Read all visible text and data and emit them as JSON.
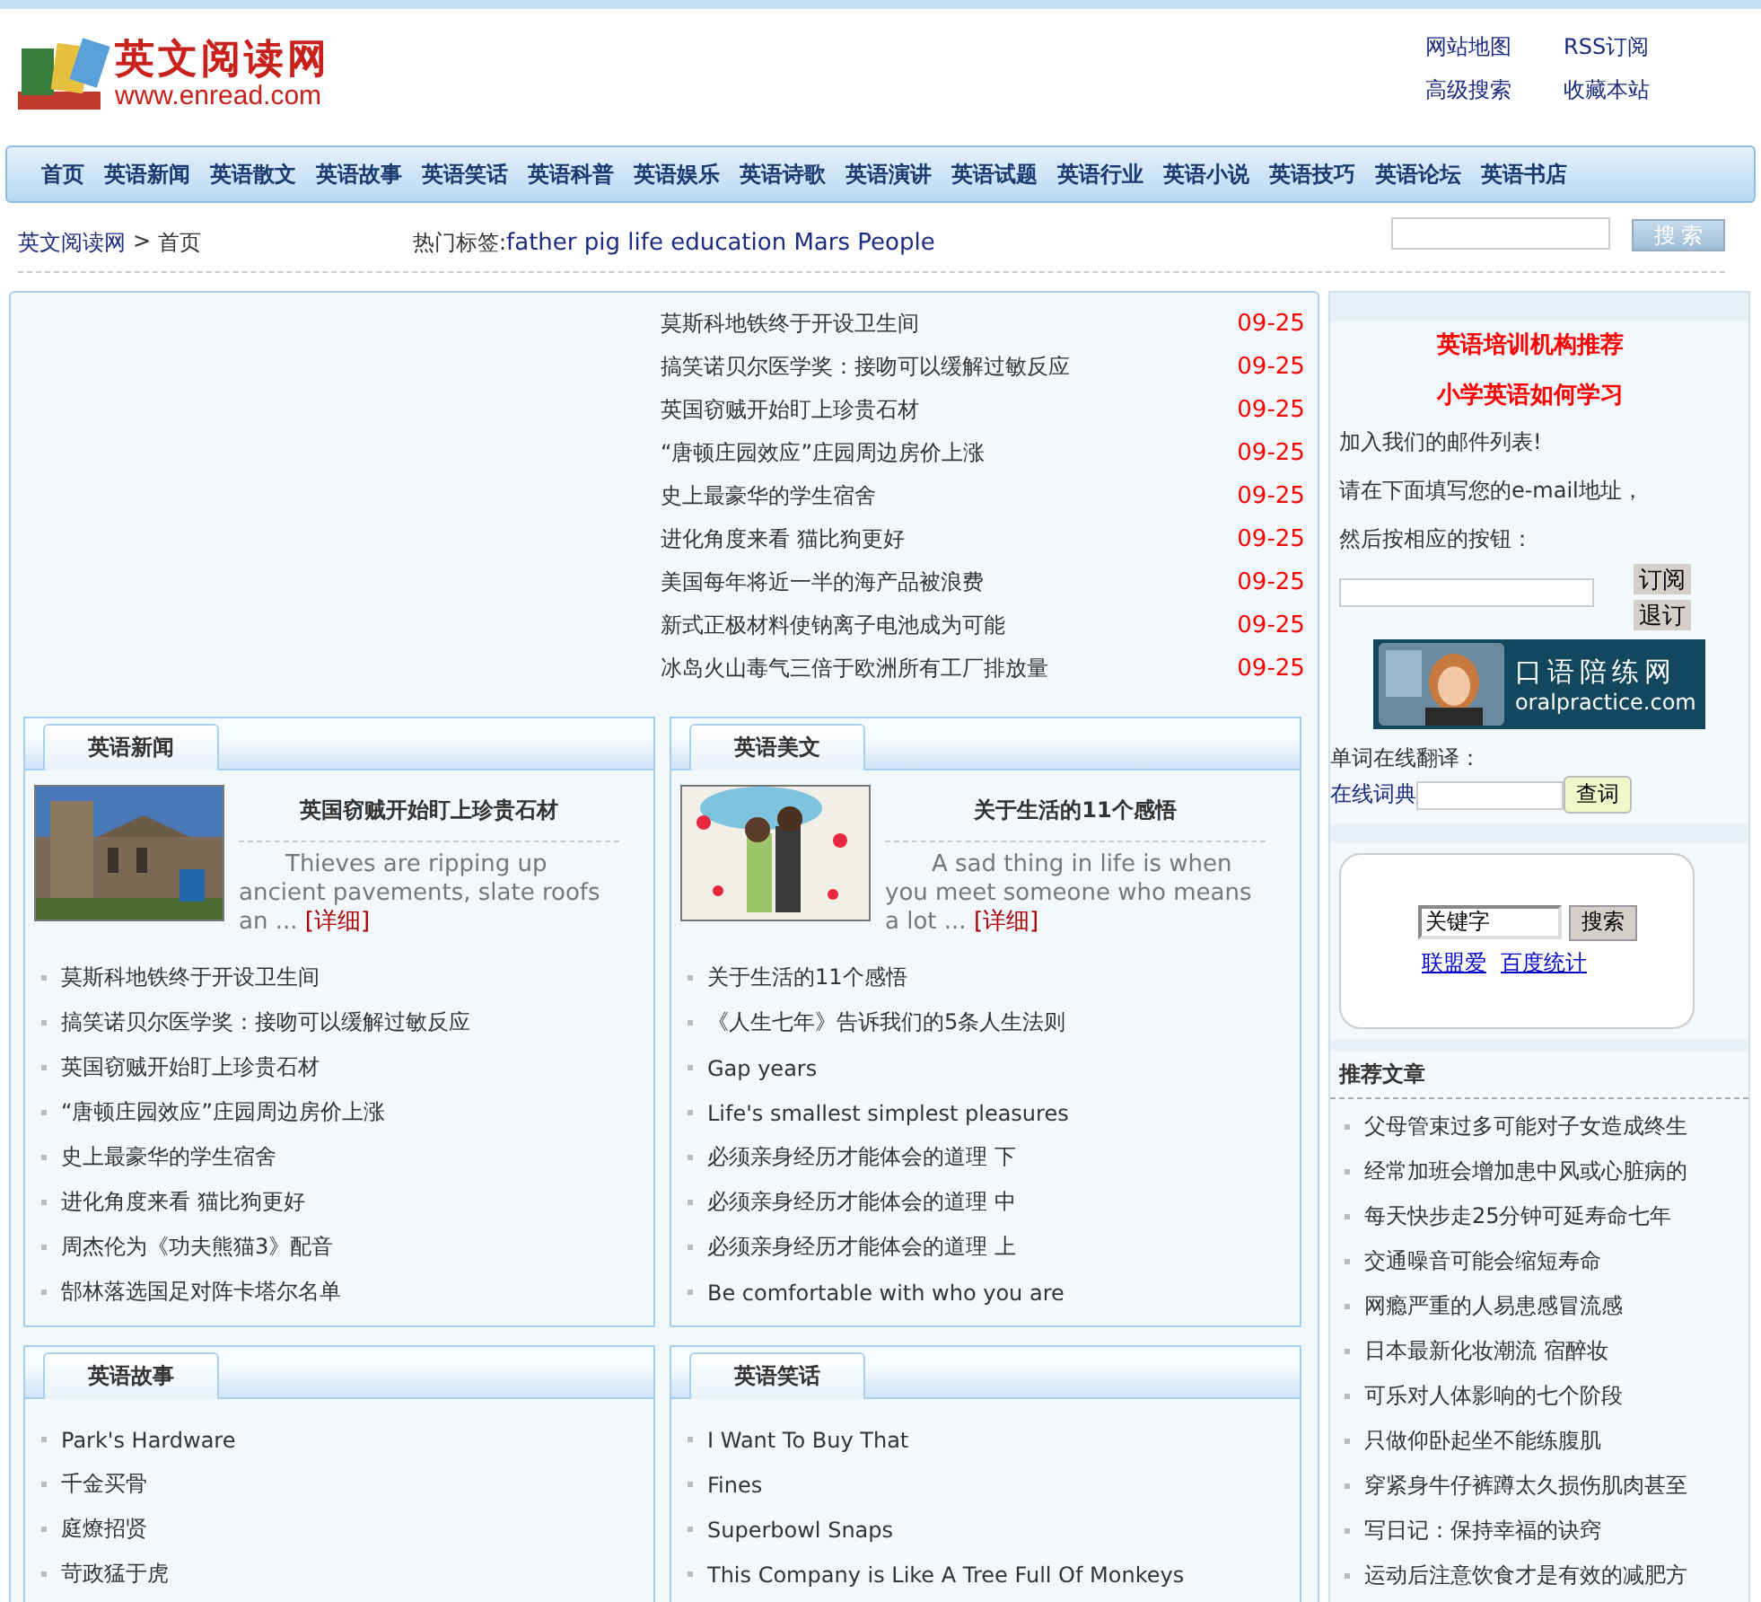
{
  "logo": {
    "title": "英文阅读网",
    "url": "www.enread.com"
  },
  "top_links": [
    "网站地图",
    "RSS订阅",
    "高级搜索",
    "收藏本站"
  ],
  "nav": [
    "首页",
    "英语新闻",
    "英语散文",
    "英语故事",
    "英语笑话",
    "英语科普",
    "英语娱乐",
    "英语诗歌",
    "英语演讲",
    "英语试题",
    "英语行业",
    "英语小说",
    "英语技巧",
    "英语论坛",
    "英语书店"
  ],
  "breadcrumb": {
    "home": "英文阅读网",
    "separator": ">",
    "current": "首页"
  },
  "hot_tags": {
    "label": "热门标签:",
    "tags": "father pig life education Mars People"
  },
  "search_button": "搜 索",
  "headlines": [
    {
      "title": "莫斯科地铁终于开设卫生间",
      "date": "09-25"
    },
    {
      "title": "搞笑诺贝尔医学奖：接吻可以缓解过敏反应",
      "date": "09-25"
    },
    {
      "title": "英国窃贼开始盯上珍贵石材",
      "date": "09-25"
    },
    {
      "title": "“唐顿庄园效应”庄园周边房价上涨",
      "date": "09-25"
    },
    {
      "title": "史上最豪华的学生宿舍",
      "date": "09-25"
    },
    {
      "title": "进化角度来看 猫比狗更好",
      "date": "09-25"
    },
    {
      "title": "美国每年将近一半的海产品被浪费",
      "date": "09-25"
    },
    {
      "title": "新式正极材料使钠离子电池成为可能",
      "date": "09-25"
    },
    {
      "title": "冰岛火山毒气三倍于欧洲所有工厂排放量",
      "date": "09-25"
    }
  ],
  "sections": [
    {
      "title": "英语新闻",
      "feature": {
        "kind": "picture",
        "title": "英国窃贼开始盯上珍贵石材",
        "summary": "Thieves are ripping up ancient pavements, slate roofs an ...",
        "more": "[详细]"
      },
      "items": [
        "莫斯科地铁终于开设卫生间",
        "搞笑诺贝尔医学奖：接吻可以缓解过敏反应",
        "英国窃贼开始盯上珍贵石材",
        "“唐顿庄园效应”庄园周边房价上涨",
        "史上最豪华的学生宿舍",
        "进化角度来看 猫比狗更好",
        "周杰伦为《功夫熊猫3》配音",
        "郜林落选国足对阵卡塔尔名单"
      ]
    },
    {
      "title": "英语美文",
      "feature": {
        "kind": "picture",
        "title": "关于生活的11个感悟",
        "summary": "A sad thing in life is when you meet someone who means a lot ...",
        "more": "[详细]"
      },
      "items": [
        "关于生活的11个感悟",
        "《人生七年》告诉我们的5条人生法则",
        "Gap years",
        "Life's smallest simplest pleasures",
        "必须亲身经历才能体会的道理 下",
        "必须亲身经历才能体会的道理 中",
        "必须亲身经历才能体会的道理 上",
        "Be comfortable with who you are"
      ]
    },
    {
      "title": "英语故事",
      "items": [
        "Park's Hardware",
        "千金买骨",
        "庭燎招贤",
        "苛政猛于虎"
      ]
    },
    {
      "title": "英语笑话",
      "items": [
        "I Want To Buy That",
        "Fines",
        "Superbowl Snaps",
        "This Company is Like A Tree Full Of Monkeys"
      ]
    }
  ],
  "sidebar": {
    "promo_links": [
      "英语培训机构推荐",
      "小学英语如何学习"
    ],
    "mail_texts": [
      "加入我们的邮件列表!",
      "请在下面填写您的e-mail地址，",
      "然后按相应的按钮："
    ],
    "mail_buttons": [
      "订阅",
      "退订"
    ],
    "banner": {
      "name": "口语陪练网",
      "url": "oralpractice.com"
    },
    "dict_label": "单词在线翻译：",
    "dict_link": "在线词典",
    "dict_button": "查词",
    "keyword_value": "关键字",
    "keyword_button": "搜索",
    "box_links": [
      "联盟爱",
      "百度统计"
    ],
    "recommend_title": "推荐文章",
    "recommend": [
      "父母管束过多可能对子女造成终生",
      "经常加班会增加患中风或心脏病的",
      "每天快步走25分钟可延寿命七年",
      "交通噪音可能会缩短寿命",
      "网瘾严重的人易患感冒流感",
      "日本最新化妆潮流 宿醉妆",
      "可乐对人体影响的七个阶段",
      "只做仰卧起坐不能练腹肌",
      "穿紧身牛仔裤蹲太久损伤肌肉甚至",
      "写日记：保持幸福的诀窍",
      "运动后注意饮食才是有效的减肥方"
    ]
  }
}
